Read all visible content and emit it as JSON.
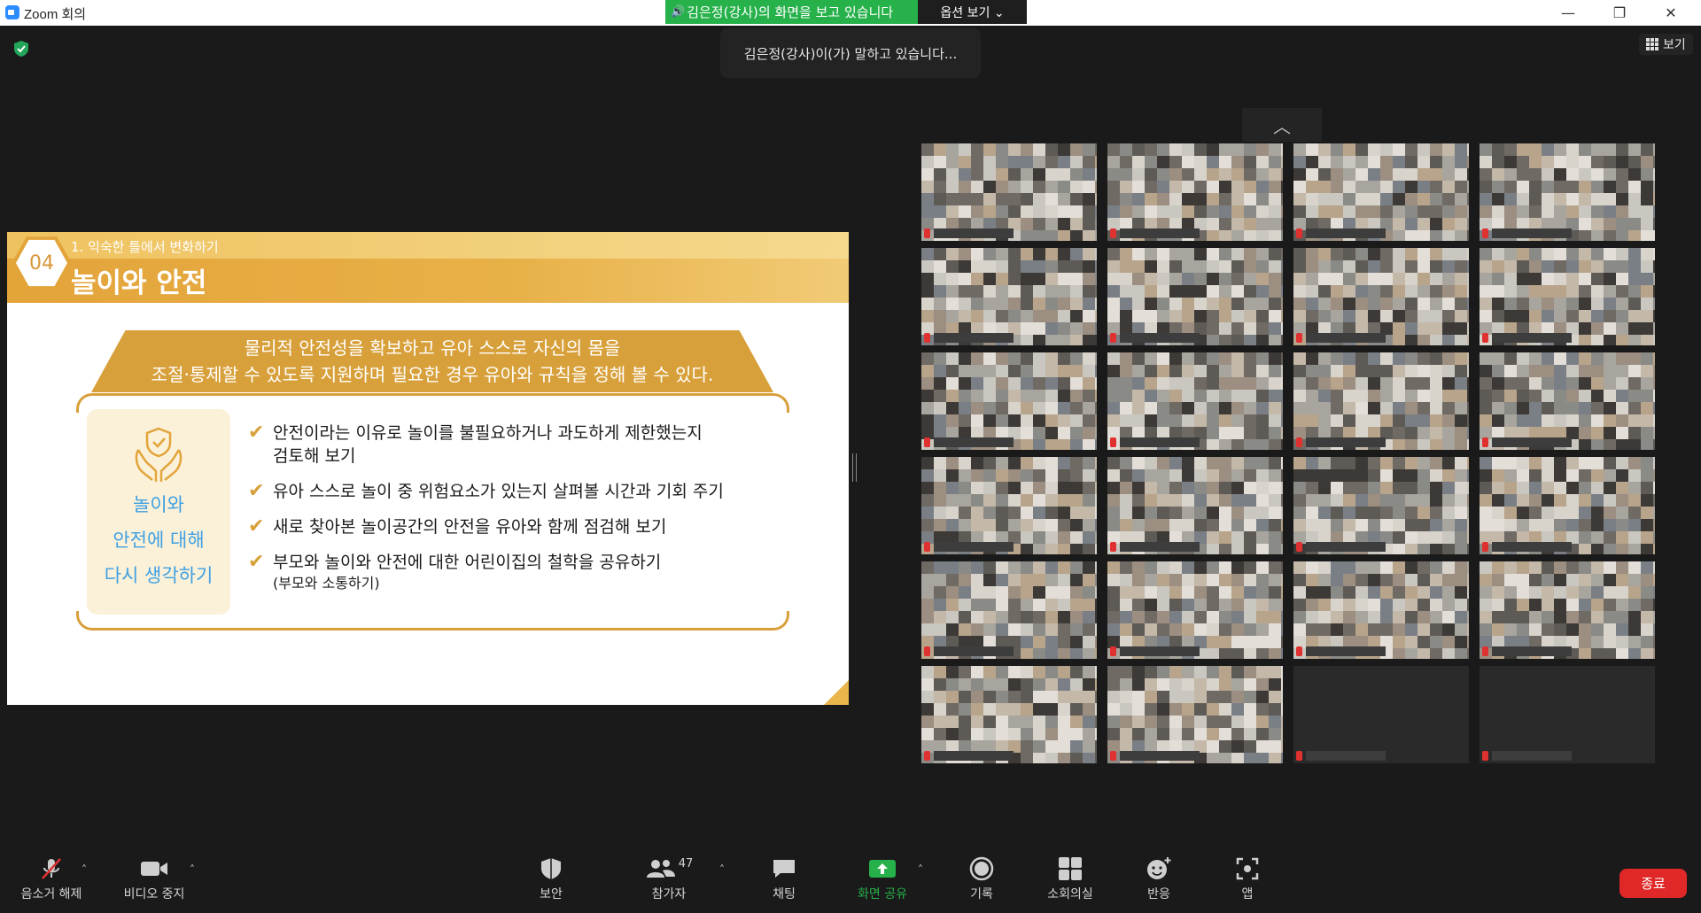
{
  "window": {
    "title": "Zoom 회의",
    "minimize": "—",
    "restore": "❐",
    "close": "✕"
  },
  "share_banner": {
    "text": "김은정(강사)의 화면을 보고 있습니다",
    "options_label": "옵션 보기 ⌄"
  },
  "speaking_toast": "김은정(강사)이(가) 말하고 있습니다...",
  "view_button": "보기",
  "slide": {
    "number": "04",
    "section": "1. 익숙한 틀에서 변화하기",
    "title": "놀이와 안전",
    "banner_line1": "물리적 안전성을 확보하고 유아 스스로 자신의 몸을",
    "banner_line2": "조절·통제할 수 있도록 지원하며 필요한 경우 유아와 규칙을 정해 볼 수 있다.",
    "left_box": [
      "놀이와",
      "안전에 대해",
      "다시 생각하기"
    ],
    "checklist": [
      {
        "text": "안전이라는 이유로 놀이를 불필요하거나 과도하게 제한했는지",
        "sub": "검토해 보기"
      },
      {
        "text": "유아 스스로 놀이 중 위험요소가 있는지 살펴볼 시간과 기회 주기",
        "sub": ""
      },
      {
        "text": "새로 찾아본 놀이공간의 안전을 유아와 함께 점검해 보기",
        "sub": ""
      },
      {
        "text": "부모와 놀이와 안전에 대한 어린이집의 철학을 공유하기",
        "sub": "(부모와 소통하기)"
      }
    ],
    "accent_color": "#d8a03a",
    "text_accent_color": "#3fa0e2"
  },
  "gallery": {
    "collapse_label": "︿"
  },
  "toolbar": {
    "mute_label": "음소거 해제",
    "video_label": "비디오 중지",
    "security_label": "보안",
    "participants_label": "참가자",
    "participants_count": "47",
    "chat_label": "채팅",
    "share_label": "화면 공유",
    "record_label": "기록",
    "breakout_label": "소회의실",
    "reactions_label": "반응",
    "apps_label": "앱",
    "end_label": "종료",
    "caret": "˄"
  },
  "colors": {
    "share_green": "#26b14a",
    "end_red": "#e02828",
    "zoom_blue": "#2d8cff"
  }
}
